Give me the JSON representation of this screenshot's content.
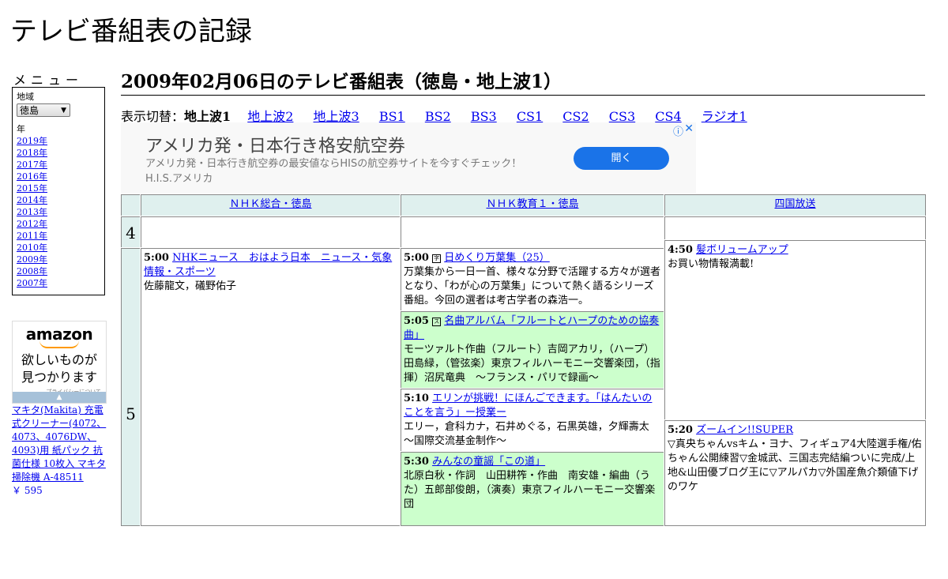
{
  "site": {
    "title": "テレビ番組表の記録"
  },
  "menu": {
    "label": "メニュー",
    "region_label": "地域",
    "region_value": "徳島",
    "year_label": "年",
    "years": [
      "2019年",
      "2018年",
      "2017年",
      "2016年",
      "2015年",
      "2014年",
      "2013年",
      "2012年",
      "2011年",
      "2010年",
      "2009年",
      "2008年",
      "2007年"
    ]
  },
  "ad_amazon": {
    "logo": "amazon",
    "copy_line1": "欲しいものが",
    "copy_line2": "見つかります",
    "privacy": "プライバシーについて",
    "arrow": "▲"
  },
  "product": {
    "title": "マキタ(Makita) 充電式クリーナー(4072、4073、4076DW、4093)用 紙パック 抗菌仕様 10枚入 マキタ 掃除機 A-48511",
    "price": "￥ 595"
  },
  "main": {
    "heading": "2009年02月06日のテレビ番組表（徳島・地上波1）",
    "switch_label": "表示切替：",
    "current_tab": "地上波1",
    "tabs": [
      "地上波2",
      "地上波3",
      "BS1",
      "BS2",
      "BS3",
      "CS1",
      "CS2",
      "CS3",
      "CS4",
      "ラジオ1"
    ]
  },
  "ad_banner": {
    "headline": "アメリカ発・日本行き格安航空券",
    "desc": "アメリカ発・日本行き航空券の最安値ならHISの航空券サイトを今すぐチェック！ H.I.S.アメリカ",
    "button": "開く",
    "info_icon": "ⓘ",
    "close_icon": "✕"
  },
  "grid": {
    "channels": [
      "ＮＨＫ総合・徳島",
      "ＮＨＫ教育１・徳島",
      "四国放送"
    ],
    "hours": [
      "4",
      "5"
    ],
    "programs": {
      "nhk_sogo": [
        {
          "time": "5:00",
          "title": "NHKニュース　おはよう日本　ニュース・気象情報・スポーツ",
          "desc": "佐藤龍文，礒野佑子"
        }
      ],
      "nhk_kyoiku": [
        {
          "time": "5:00",
          "icon": "字",
          "title": "日めくり万葉集（25）",
          "desc": "万葉集から一日一首、様々な分野で活躍する方々が選者となり、「わが心の万葉集」について熱く語るシリーズ番組。今回の選者は考古学者の森浩一。"
        },
        {
          "time": "5:05",
          "icon": "ステ",
          "title": "名曲アルバム「フルートとハープのための協奏曲」",
          "desc": "モーツァルト作曲（フルート）吉岡アカリ，（ハープ）田島緑，（管弦楽）東京フィルハーモニー交響楽団，（指揮）沼尻竜典　～フランス・パリで録画～"
        },
        {
          "time": "5:10",
          "title": "エリンが挑戦！にほんごできます。「はんたいのことを言う」ー授業ー",
          "desc": "エリー，倉科カナ，石井めぐる，石黒英雄，夕輝壽太　～国際交流基金制作～"
        },
        {
          "time": "5:30",
          "title": "みんなの童謡「この道」",
          "desc": "北原白秋・作詞　山田耕筰・作曲　南安雄・編曲（うた）五郎部俊朗，（演奏）東京フィルハーモニー交響楽団"
        }
      ],
      "shikoku": [
        {
          "time": "4:50",
          "title": "髪ボリュームアップ",
          "desc": "お買い物情報満載!"
        },
        {
          "time": "5:20",
          "title": "ズームイン!!SUPER",
          "desc": "▽真央ちゃんvsキム・ヨナ、フィギュア4大陸選手権/佑ちゃん公開練習▽金城武、三国志完結編ついに完成/上地&山田優ブログ王に▽アルパカ▽外国産魚介類値下げのワケ"
        }
      ]
    }
  }
}
